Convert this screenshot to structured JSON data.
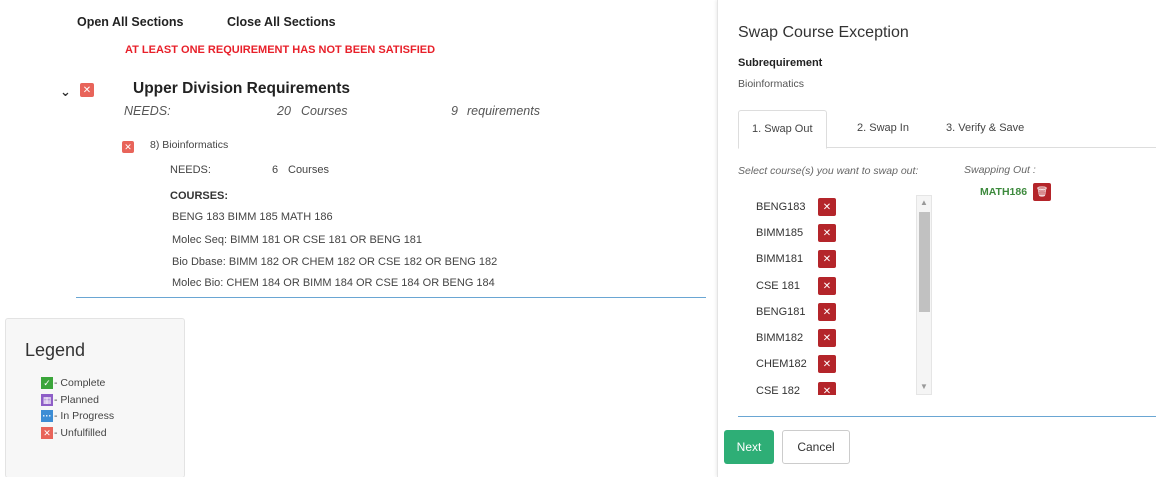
{
  "left": {
    "open_all": "Open All Sections",
    "close_all": "Close All Sections",
    "warning": "AT LEAST ONE REQUIREMENT HAS NOT BEEN SATISFIED",
    "section": {
      "title": "Upper Division Requirements",
      "needs_label": "NEEDS:",
      "needs_count": "20",
      "needs_unit": "Courses",
      "req_count": "9",
      "req_unit": "requirements"
    },
    "subsection": {
      "title": "8) Bioinformatics",
      "needs_label": "NEEDS:",
      "needs_count": "6",
      "needs_unit": "Courses",
      "courses_label": "COURSES:",
      "courses": [
        "BENG 183 BIMM 185 MATH 186",
        "Molec Seq: BIMM 181 OR CSE 181 OR BENG 181",
        "Bio Dbase: BIMM 182 OR CHEM 182 OR CSE 182 OR BENG 182",
        "Molec Bio: CHEM 184 OR BIMM 184 OR CSE 184 OR BENG 184"
      ]
    }
  },
  "legend": {
    "title": "Legend",
    "items": [
      {
        "label": "Complete",
        "color": "#3aa53a",
        "icon": "check-icon"
      },
      {
        "label": "Planned",
        "color": "#8e5ec7",
        "icon": "calendar-icon"
      },
      {
        "label": "In Progress",
        "color": "#3c8dd5",
        "icon": "ellipsis-icon"
      },
      {
        "label": "Unfulfilled",
        "color": "#e8645a",
        "icon": "x-icon"
      }
    ]
  },
  "modal": {
    "title": "Swap Course Exception",
    "subreq_label": "Subrequirement",
    "subreq_value": "Bioinformatics",
    "tabs": [
      "1. Swap Out",
      "2. Swap In",
      "3. Verify & Save"
    ],
    "select_label": "Select course(s) you want to swap out:",
    "swapping_label": "Swapping Out :",
    "swapping_items": [
      "MATH186"
    ],
    "courses": [
      "BENG183",
      "BIMM185",
      "BIMM181",
      "CSE 181",
      "BENG181",
      "BIMM182",
      "CHEM182",
      "CSE 182"
    ],
    "next": "Next",
    "cancel": "Cancel"
  }
}
